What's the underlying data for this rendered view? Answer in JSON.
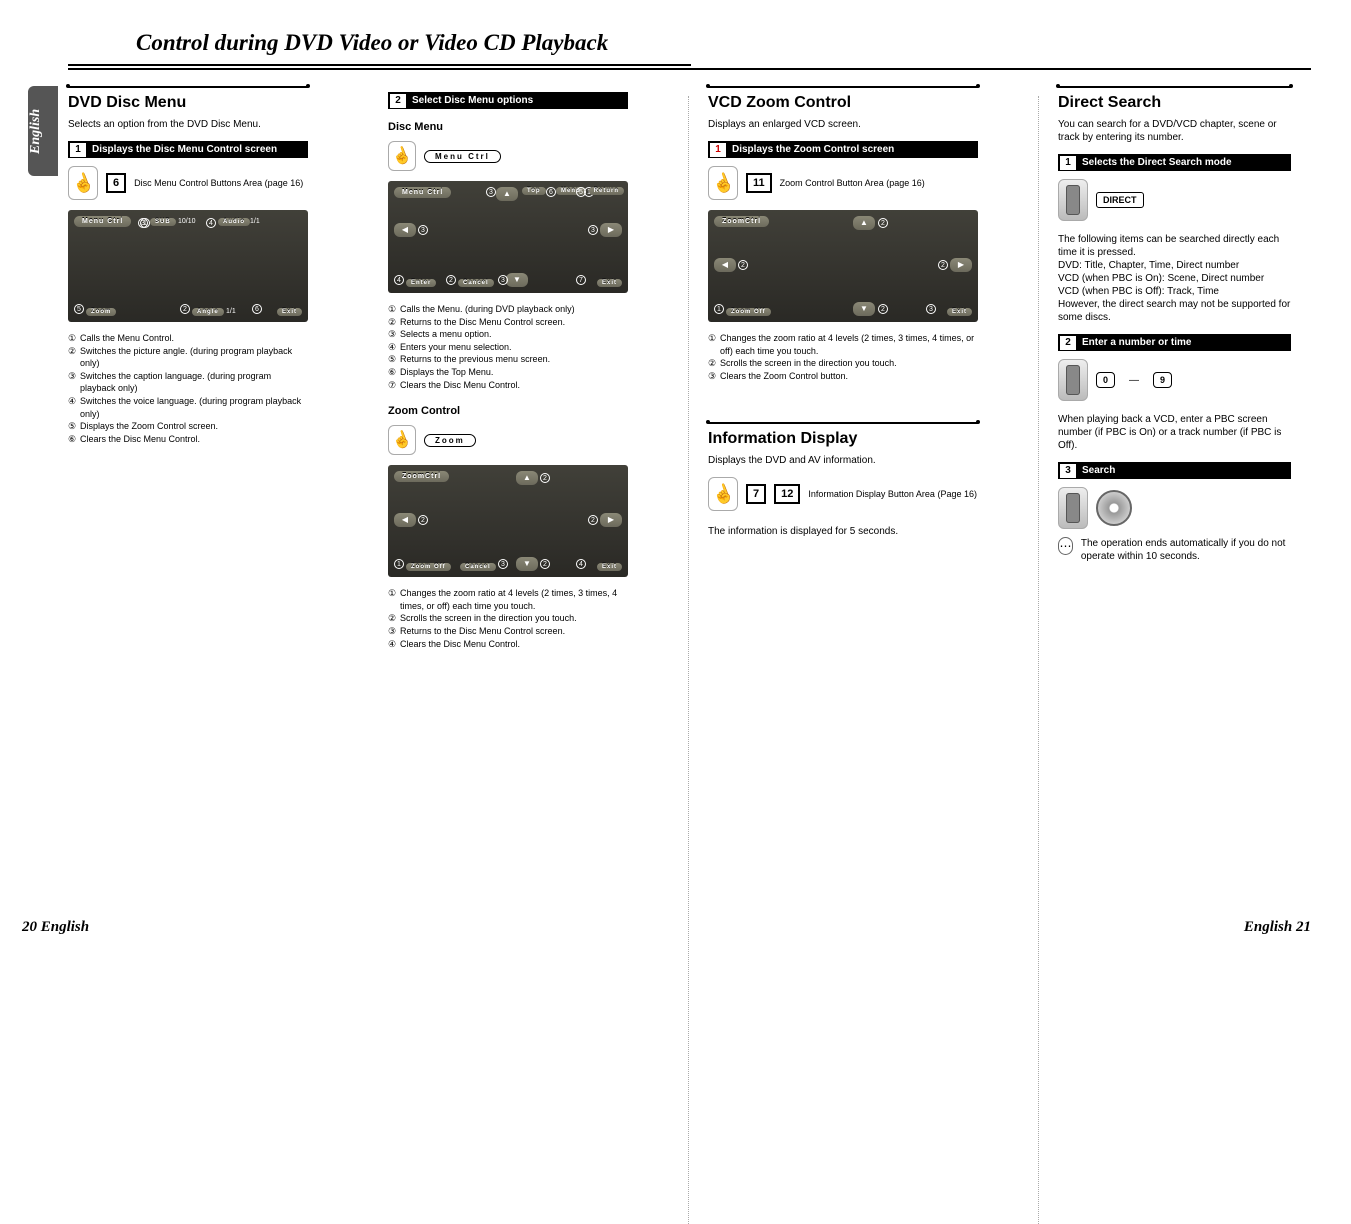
{
  "page_title": "Control during DVD Video or Video CD Playback",
  "side_tab": "English",
  "footer_left": "20 English",
  "footer_right": "English 21",
  "col1": {
    "heading": "DVD Disc Menu",
    "intro": "Selects an option from the DVD Disc Menu.",
    "step1": {
      "num": "1",
      "label": "Displays the Disc Menu Control screen"
    },
    "touch": {
      "num": "6",
      "caption": "Disc Menu Control Buttons Area (page 16)"
    },
    "screen": {
      "menu_ctrl": "Menu Ctrl",
      "sub": "SUB",
      "sub_val": "10/10",
      "audio": "Audio",
      "audio_val": "1/1",
      "zoom": "Zoom",
      "angle": "Angle",
      "angle_val": "1/1",
      "exit": "Exit"
    },
    "list": [
      "Calls the Menu Control.",
      "Switches the picture angle. (during program playback only)",
      "Switches the caption language. (during program playback only)",
      "Switches the voice language. (during program playback only)",
      "Displays the Zoom Control screen.",
      "Clears the Disc Menu Control."
    ]
  },
  "col2": {
    "step2": {
      "num": "2",
      "label": "Select Disc Menu options"
    },
    "disc_menu_heading": "Disc Menu",
    "menuctrl_label": "Menu Ctrl",
    "screen1": {
      "menu_ctrl": "Menu Ctrl",
      "top": "Top",
      "menu": "Menu",
      "return": "Return",
      "enter": "Enter",
      "cancel": "Cancel",
      "exit": "Exit"
    },
    "list1": [
      "Calls the Menu. (during DVD playback only)",
      "Returns to the Disc Menu Control screen.",
      "Selects a menu option.",
      "Enters your menu selection.",
      "Returns to the previous menu screen.",
      "Displays the Top Menu.",
      "Clears the Disc Menu Control."
    ],
    "zoom_heading": "Zoom Control",
    "zoom_label": "Zoom",
    "screen2": {
      "zoom_ctrl": "ZoomCtrl",
      "zoom_off": "Zoom Off",
      "cancel": "Cancel",
      "exit": "Exit"
    },
    "list2": [
      "Changes the zoom ratio at 4 levels (2 times, 3 times, 4 times, or off) each time you touch.",
      "Scrolls the screen in the direction you touch.",
      "Returns to the Disc Menu Control screen.",
      "Clears the Disc Menu Control."
    ]
  },
  "col3": {
    "heading1": "VCD Zoom Control",
    "intro1": "Displays an enlarged VCD screen.",
    "step1": {
      "num": "1",
      "label": "Displays the Zoom Control screen"
    },
    "touch1": {
      "num": "11",
      "caption": "Zoom Control Button Area (page 16)"
    },
    "screen": {
      "zoom_ctrl": "ZoomCtrl",
      "zoom_off": "Zoom Off",
      "exit": "Exit"
    },
    "list1": [
      "Changes the zoom ratio at 4 levels (2 times, 3 times, 4 times, or off) each time you touch.",
      "Scrolls the screen in the direction you touch.",
      "Clears the Zoom Control button."
    ],
    "heading2": "Information Display",
    "intro2": "Displays the DVD and AV information.",
    "touch2": {
      "num1": "7",
      "num2": "12",
      "caption": "Information Display Button Area (Page 16)"
    },
    "para2": "The information is displayed for 5 seconds."
  },
  "col4": {
    "heading": "Direct Search",
    "intro": "You can search for a DVD/VCD chapter, scene or track by entering its number.",
    "step1": {
      "num": "1",
      "label": "Selects the Direct Search mode"
    },
    "direct_label": "DIRECT",
    "para1": "The following items can be searched directly each time it is pressed.\nDVD: Title, Chapter, Time, Direct number\nVCD (when PBC is On): Scene, Direct number\nVCD (when PBC is Off): Track, Time\nHowever, the direct search may not be supported for some discs.",
    "step2": {
      "num": "2",
      "label": "Enter a number or time"
    },
    "key0": "0",
    "key9": "9",
    "para2": "When playing back a VCD, enter a PBC screen number (if PBC is On) or a track number (if PBC is Off).",
    "step3": {
      "num": "3",
      "label": "Search"
    },
    "note": "The operation ends automatically if you do not operate within 10 seconds."
  }
}
